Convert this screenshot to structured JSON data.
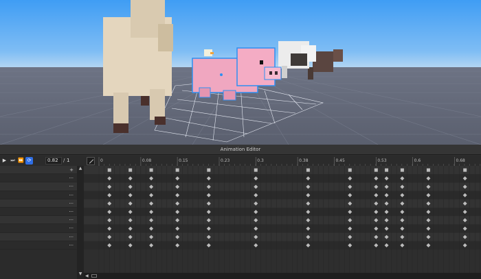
{
  "editor": {
    "title": "Animation Editor",
    "toolbar": {
      "play_icon": "play-icon",
      "step_icon": "step-forward-icon",
      "end_icon": "skip-to-end-icon",
      "loop_icon": "loop-icon",
      "current_time": "0.82",
      "separator": "/",
      "length": "1"
    },
    "ruler_labels": [
      "0",
      "0.08",
      "0.15",
      "0.23",
      "0.3",
      "0.38",
      "0.45",
      "0.53",
      "0.6",
      "0.68"
    ],
    "ruler_values": [
      0,
      0.08,
      0.15,
      0.23,
      0.3,
      0.38,
      0.45,
      0.53,
      0.6,
      0.68
    ],
    "add_track_label": "+",
    "track_menu_label": "···",
    "track_count": 10,
    "keyframe_times": [
      0.02,
      0.06,
      0.1,
      0.15,
      0.21,
      0.3,
      0.4,
      0.48,
      0.53,
      0.55,
      0.58,
      0.63,
      0.7,
      0.8
    ],
    "colors": {
      "accent": "#2f6ee5",
      "keyframe": "#bcbcbc",
      "selection": "#2e8ff0",
      "pig": "#f3a4bd"
    }
  }
}
